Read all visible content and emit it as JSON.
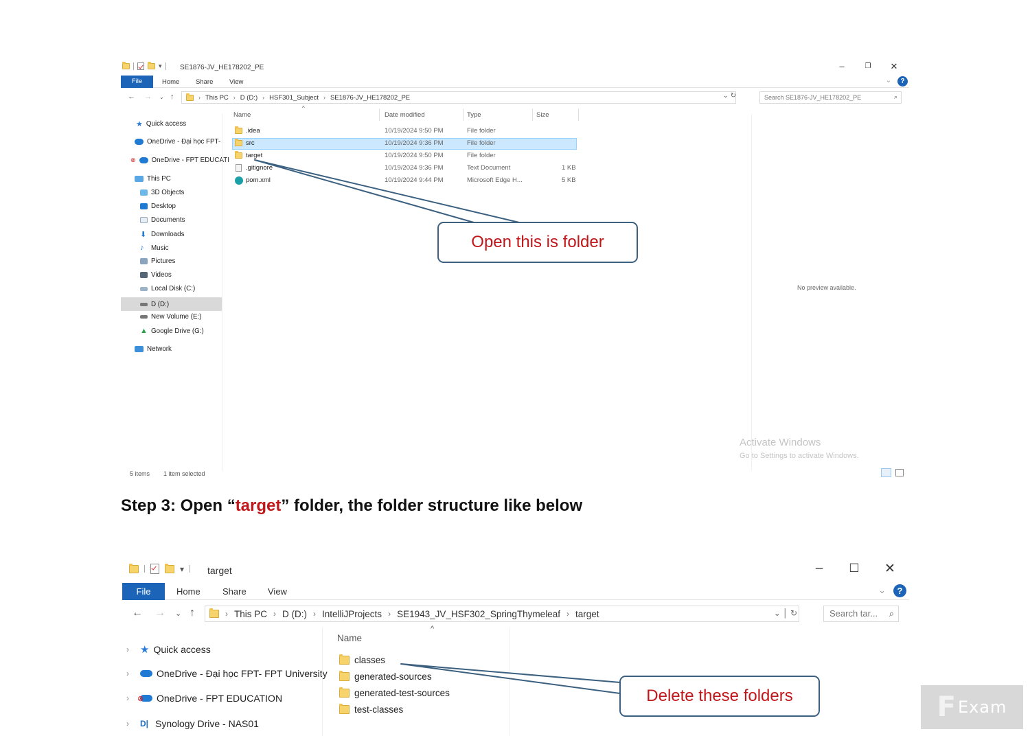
{
  "window1": {
    "title": "SE1876-JV_HE178202_PE",
    "tabs": {
      "file": "File",
      "home": "Home",
      "share": "Share",
      "view": "View"
    },
    "breadcrumb": [
      "This PC",
      "D (D:)",
      "HSF301_Subject",
      "SE1876-JV_HE178202_PE"
    ],
    "search_placeholder": "Search SE1876-JV_HE178202_PE",
    "nav": {
      "quick_access": "Quick access",
      "onedrive_dh": "OneDrive - Đại học FPT-",
      "onedrive_fpt": "OneDrive - FPT EDUCATI",
      "this_pc": "This PC",
      "objects3d": "3D Objects",
      "desktop": "Desktop",
      "documents": "Documents",
      "downloads": "Downloads",
      "music": "Music",
      "pictures": "Pictures",
      "videos": "Videos",
      "local_disk": "Local Disk (C:)",
      "d_drive": "D (D:)",
      "new_volume": "New Volume (E:)",
      "google_drive": "Google Drive (G:)",
      "network": "Network"
    },
    "columns": {
      "name": "Name",
      "date": "Date modified",
      "type": "Type",
      "size": "Size"
    },
    "files": [
      {
        "name": ".idea",
        "date": "10/19/2024 9:50 PM",
        "type": "File folder",
        "size": ""
      },
      {
        "name": "src",
        "date": "10/19/2024 9:36 PM",
        "type": "File folder",
        "size": ""
      },
      {
        "name": "target",
        "date": "10/19/2024 9:50 PM",
        "type": "File folder",
        "size": ""
      },
      {
        "name": ".gitignore",
        "date": "10/19/2024 9:36 PM",
        "type": "Text Document",
        "size": "1 KB"
      },
      {
        "name": "pom.xml",
        "date": "10/19/2024 9:44 PM",
        "type": "Microsoft Edge H...",
        "size": "5 KB"
      }
    ],
    "no_preview": "No preview available.",
    "activate_title": "Activate Windows",
    "activate_sub": "Go to Settings to activate Windows.",
    "status_items": "5 items",
    "status_selected": "1 item selected"
  },
  "callout1": "Open this is folder",
  "step": {
    "prefix": "Step 3: Open “",
    "highlight": "target",
    "suffix": "” folder, the folder structure like below"
  },
  "window2": {
    "title": "target",
    "tabs": {
      "file": "File",
      "home": "Home",
      "share": "Share",
      "view": "View"
    },
    "breadcrumb": [
      "This PC",
      "D (D:)",
      "IntelliJProjects",
      "SE1943_JV_HSF302_SpringThymeleaf",
      "target"
    ],
    "search_placeholder": "Search tar...",
    "nav": {
      "quick_access": "Quick access",
      "onedrive_dh": "OneDrive - Đại học FPT- FPT University",
      "onedrive_fpt": "OneDrive - FPT EDUCATION",
      "synology": "Synology Drive - NAS01"
    },
    "column_name": "Name",
    "folders": [
      "classes",
      "generated-sources",
      "generated-test-sources",
      "test-classes"
    ]
  },
  "callout2": "Delete these folders",
  "watermark": "Exam",
  "colors": {
    "accent": "#1c64b8",
    "callout_text": "#c0171b",
    "callout_border": "#3b6080",
    "selection": "#cce8ff"
  }
}
